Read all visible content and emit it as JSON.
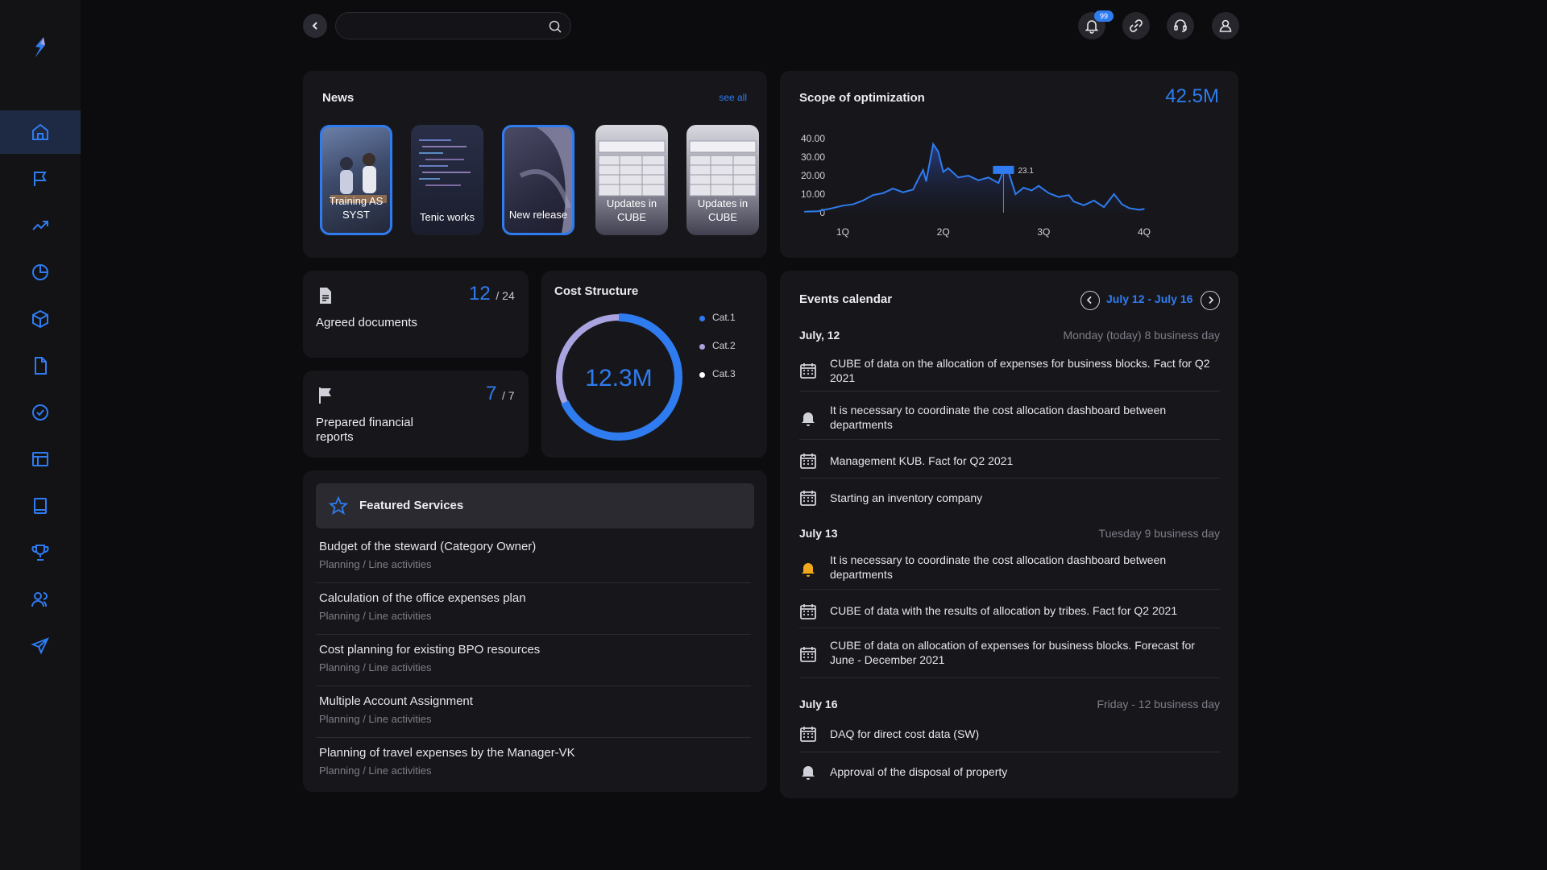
{
  "colors": {
    "accent": "#2f7cf0",
    "background": "#0c0c0e",
    "card": "#17171b",
    "warning": "#f0a81c"
  },
  "sidebar": {
    "items": [
      {
        "icon": "home-icon",
        "active": true
      },
      {
        "icon": "flag-icon"
      },
      {
        "icon": "trend-up-icon"
      },
      {
        "icon": "pie-chart-icon"
      },
      {
        "icon": "cube-icon"
      },
      {
        "icon": "document-icon"
      },
      {
        "icon": "check-circle-icon"
      },
      {
        "icon": "layout-icon"
      },
      {
        "icon": "book-icon"
      },
      {
        "icon": "trophy-icon"
      },
      {
        "icon": "users-icon"
      },
      {
        "icon": "airplane-icon"
      }
    ]
  },
  "topbar": {
    "search_placeholder": "",
    "notification_count": "99"
  },
  "news": {
    "title": "News",
    "see_all": "see all",
    "items": [
      {
        "label": "Training AS SYST",
        "selected": true
      },
      {
        "label": "Tenic works",
        "selected": false
      },
      {
        "label": "New release",
        "selected": true
      },
      {
        "label": "Updates in CUBE",
        "selected": false
      },
      {
        "label": "Updates in CUBE",
        "selected": false
      }
    ]
  },
  "scope": {
    "title": "Scope of optimization",
    "total": "42.5M",
    "highlight_label": "23.1"
  },
  "chart_data": {
    "type": "area",
    "title": "Scope of optimization",
    "x_ticks": [
      "1Q",
      "2Q",
      "3Q",
      "4Q"
    ],
    "y_ticks": [
      "40.00",
      "30.00",
      "20.00",
      "10.00",
      "0"
    ],
    "ylim": [
      0,
      40
    ],
    "x_range": [
      0.6,
      4.0
    ],
    "values": [
      [
        0.62,
        0.5
      ],
      [
        0.75,
        0.8
      ],
      [
        0.9,
        2.5
      ],
      [
        1.0,
        3.8
      ],
      [
        1.1,
        4.5
      ],
      [
        1.2,
        6.5
      ],
      [
        1.3,
        9.5
      ],
      [
        1.4,
        10.5
      ],
      [
        1.5,
        13.0
      ],
      [
        1.6,
        11.0
      ],
      [
        1.7,
        12.5
      ],
      [
        1.75,
        18.0
      ],
      [
        1.8,
        23.0
      ],
      [
        1.83,
        17.0
      ],
      [
        1.9,
        37.0
      ],
      [
        1.95,
        33.0
      ],
      [
        2.0,
        22.0
      ],
      [
        2.05,
        24.0
      ],
      [
        2.15,
        19.0
      ],
      [
        2.25,
        20.0
      ],
      [
        2.35,
        17.5
      ],
      [
        2.45,
        19.0
      ],
      [
        2.55,
        16.0
      ],
      [
        2.6,
        23.1
      ],
      [
        2.65,
        22.0
      ],
      [
        2.72,
        10.0
      ],
      [
        2.8,
        13.5
      ],
      [
        2.88,
        12.0
      ],
      [
        2.95,
        14.5
      ],
      [
        3.05,
        10.5
      ],
      [
        3.15,
        8.5
      ],
      [
        3.25,
        9.5
      ],
      [
        3.3,
        6.0
      ],
      [
        3.4,
        4.0
      ],
      [
        3.5,
        6.5
      ],
      [
        3.6,
        3.0
      ],
      [
        3.7,
        10.0
      ],
      [
        3.78,
        4.5
      ],
      [
        3.85,
        2.5
      ],
      [
        3.95,
        1.5
      ],
      [
        4.0,
        2.0
      ]
    ],
    "annotation": {
      "x": 2.6,
      "y": 23.1,
      "label": "23.1"
    },
    "grid": false
  },
  "stats": {
    "docs": {
      "value": "12",
      "total": "/ 24",
      "label": "Agreed documents"
    },
    "reports": {
      "value": "7",
      "total": "/ 7",
      "label": "Prepared financial reports"
    }
  },
  "cost": {
    "title": "Cost Structure",
    "total": "12.3M",
    "legend": [
      "Cat.1",
      "Cat.2",
      "Cat.3"
    ],
    "legend_colors": [
      "#2f7cf0",
      "#a9a3e0",
      "#ffffff"
    ],
    "share_cat1": 0.68
  },
  "featured": {
    "title": "Featured Services",
    "items": [
      {
        "title": "Budget of the steward (Category Owner)",
        "sub": "Planning / Line activities"
      },
      {
        "title": "Calculation of the office expenses plan",
        "sub": "Planning / Line activities"
      },
      {
        "title": "Cost planning for existing BPO resources",
        "sub": "Planning / Line activities"
      },
      {
        "title": "Multiple Account Assignment",
        "sub": "Planning / Line activities"
      },
      {
        "title": "Planning of travel expenses by the Manager-VK",
        "sub": "Planning / Line activities"
      }
    ]
  },
  "events": {
    "title": "Events calendar",
    "range": "July 12 - July 16",
    "days": [
      {
        "date": "July, 12",
        "meta": "Monday (today) 8 business day",
        "items": [
          {
            "icon": "calendar-icon",
            "text": "CUBE of data on the allocation of expenses for business blocks. Fact for Q2 2021"
          },
          {
            "icon": "bell-icon",
            "text": "It is necessary to coordinate the cost allocation dashboard between departments"
          },
          {
            "icon": "calendar-icon",
            "text": "Management KUB. Fact for Q2 2021"
          },
          {
            "icon": "calendar-icon",
            "text": "Starting an inventory company"
          }
        ]
      },
      {
        "date": "July 13",
        "meta": "Tuesday 9 business day",
        "items": [
          {
            "icon": "bell-warning-icon",
            "text": "It is necessary to coordinate the cost allocation dashboard between departments"
          },
          {
            "icon": "calendar-icon",
            "text": "CUBE of data with the results of allocation by tribes. Fact for Q2 2021"
          },
          {
            "icon": "calendar-icon",
            "text": "CUBE of data on allocation of expenses for business blocks. Forecast for June - December 2021"
          }
        ]
      },
      {
        "date": "July 16",
        "meta": "Friday - 12 business day",
        "items": [
          {
            "icon": "calendar-icon",
            "text": "DAQ for direct cost data (SW)"
          },
          {
            "icon": "bell-icon",
            "text": "Approval of the disposal of property"
          }
        ]
      }
    ]
  }
}
